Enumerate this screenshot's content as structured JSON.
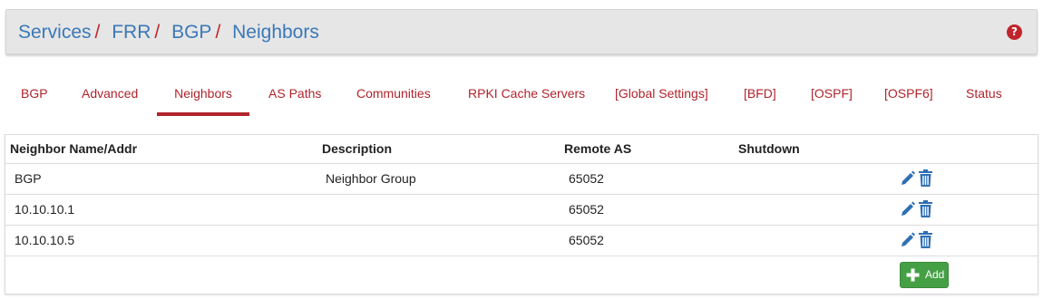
{
  "breadcrumb": {
    "items": [
      "Services",
      "FRR",
      "BGP",
      "Neighbors"
    ],
    "separator": "/"
  },
  "help": {
    "icon": "question-circle-icon",
    "glyph": "?"
  },
  "tabs": [
    {
      "label": "BGP"
    },
    {
      "label": "Advanced"
    },
    {
      "label": "Neighbors",
      "active": true
    },
    {
      "label": "AS Paths"
    },
    {
      "label": "Communities"
    },
    {
      "label": "RPKI Cache Servers"
    },
    {
      "label": "[Global Settings]"
    },
    {
      "label": "[BFD]"
    },
    {
      "label": "[OSPF]"
    },
    {
      "label": "[OSPF6]"
    },
    {
      "label": "Status"
    }
  ],
  "table": {
    "headers": [
      "Neighbor Name/Addr",
      "Description",
      "Remote AS",
      "Shutdown"
    ],
    "rows": [
      {
        "name": "BGP",
        "description": "Neighbor Group",
        "remote_as": "65052",
        "shutdown": ""
      },
      {
        "name": "10.10.10.1",
        "description": "",
        "remote_as": "65052",
        "shutdown": ""
      },
      {
        "name": "10.10.10.5",
        "description": "",
        "remote_as": "65052",
        "shutdown": ""
      }
    ],
    "row_actions": [
      "pencil-icon",
      "trash-icon"
    ],
    "add_button_label": "Add"
  },
  "colors": {
    "link_blue": "#3b78b8",
    "accent_red": "#b0242c",
    "icon_blue": "#2f6fb3",
    "success_green": "#45a045"
  }
}
